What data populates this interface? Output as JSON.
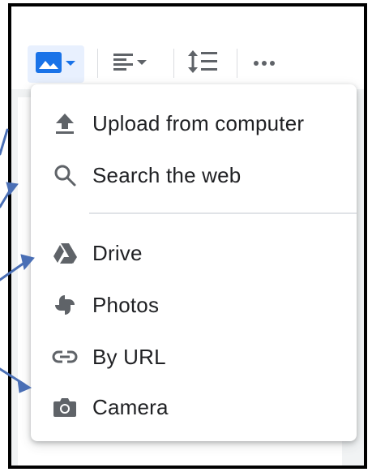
{
  "toolbar": {
    "image_button_icon": "image-icon",
    "dropdown_icon": "caret-down-icon",
    "align_icon": "align-left-icon",
    "line_spacing_icon": "line-spacing-icon",
    "more_icon": "more-horiz-icon"
  },
  "menu": {
    "items": [
      {
        "label": "Upload from computer",
        "icon": "upload-icon"
      },
      {
        "label": "Search the web",
        "icon": "search-icon"
      },
      {
        "label": "Drive",
        "icon": "drive-icon"
      },
      {
        "label": "Photos",
        "icon": "photos-icon"
      },
      {
        "label": "By URL",
        "icon": "link-icon"
      },
      {
        "label": "Camera",
        "icon": "camera-icon"
      }
    ]
  },
  "colors": {
    "accent": "#1a73e8",
    "icon_gray": "#5f6368",
    "arrow_blue": "#4a6fb5"
  }
}
